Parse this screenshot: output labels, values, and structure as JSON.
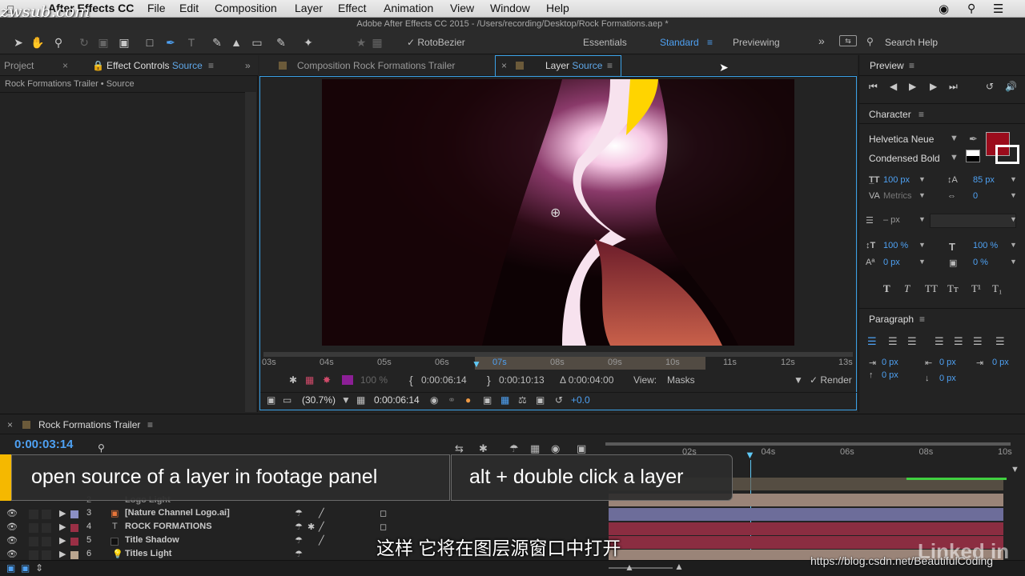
{
  "menubar": {
    "app_name": "After Effects CC",
    "items": [
      "File",
      "Edit",
      "Composition",
      "Layer",
      "Effect",
      "Animation",
      "View",
      "Window",
      "Help"
    ]
  },
  "titlebar": {
    "title": "Adobe After Effects CC 2015 - /Users/recording/Desktop/Rock Formations.aep *"
  },
  "watermark_top": "zwsub.com",
  "toolbar": {
    "rotobezier_label": "RotoBezier",
    "workspaces": [
      "Essentials",
      "Standard",
      "Previewing"
    ],
    "active_workspace": "Standard",
    "search_placeholder": "Search Help"
  },
  "left_panel": {
    "tab_project": "Project",
    "tab_effect_controls": "Effect Controls",
    "tab_effect_controls_source": "Source",
    "breadcrumb": "Rock Formations Trailer • Source"
  },
  "viewer": {
    "tab_composition": "Composition Rock Formations Trailer",
    "tab_layer": "Layer",
    "tab_layer_source": "Source",
    "ruler_labels": [
      "03s",
      "04s",
      "05s",
      "06s",
      "07s",
      "08s",
      "09s",
      "10s",
      "11s",
      "12s",
      "13s"
    ],
    "opacity": "100 %",
    "in_time": "0:00:06:14",
    "out_time": "0:00:10:13",
    "duration": "Δ 0:00:04:00",
    "view_label": "View:",
    "view_value": "Masks",
    "render_label": "Render",
    "zoom": "(30.7%)",
    "current_time": "0:00:06:14",
    "exposure": "+0.0"
  },
  "preview": {
    "title": "Preview"
  },
  "character": {
    "title": "Character",
    "font_family": "Helvetica Neue",
    "font_style": "Condensed Bold",
    "font_size": "100 px",
    "leading": "85 px",
    "kerning": "Metrics",
    "tracking": "0",
    "stroke_width": "– px",
    "vertical_scale": "100 %",
    "horizontal_scale": "100 %",
    "baseline_shift": "0 px",
    "tsume": "0 %",
    "fill_color": "#9b0c1c",
    "style_buttons": [
      "T",
      "T",
      "TT",
      "Tт",
      "T¹",
      "T₁"
    ]
  },
  "paragraph": {
    "title": "Paragraph",
    "indent_left": "0 px",
    "indent_first": "0 px",
    "indent_right": "0 px",
    "space_before": "0 px",
    "space_after": "0 px"
  },
  "timeline": {
    "title": "Rock Formations Trailer",
    "current_time": "0:00:03:14",
    "ruler_labels": [
      "02s",
      "04s",
      "06s",
      "08s",
      "10s"
    ],
    "layers": [
      {
        "num": "2",
        "name": "Logo Light",
        "color": "#8b8fc4"
      },
      {
        "num": "3",
        "name": "[Nature Channel Logo.ai]",
        "color": "#8b8fc4"
      },
      {
        "num": "4",
        "name": "ROCK FORMATIONS",
        "color": "#9a2f45"
      },
      {
        "num": "5",
        "name": "Title Shadow",
        "color": "#9a2f45"
      },
      {
        "num": "6",
        "name": "Titles Light",
        "color": "#b9a58f"
      }
    ]
  },
  "caption": {
    "left": "open source of a layer in footage panel",
    "right": "alt + double click a layer"
  },
  "subtitle_cn": "这样  它将在图层源窗口中打开",
  "watermark_url": "https://blog.csdn.net/BeautifulCoding",
  "linkedin": "Linked in"
}
